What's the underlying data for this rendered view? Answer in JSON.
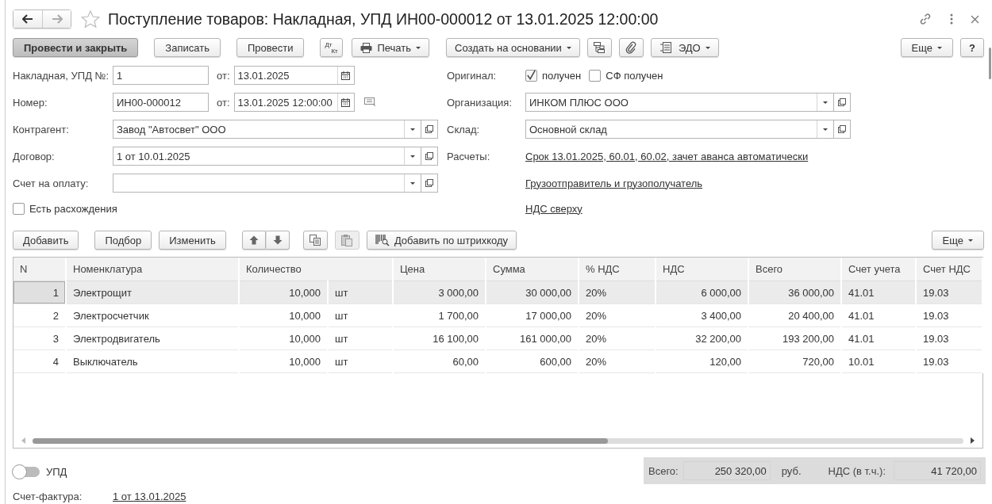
{
  "window": {
    "title": "Поступление товаров: Накладная, УПД ИН00-000012 от 13.01.2025 12:00:00"
  },
  "toolbar": [
    {
      "kind": "primary",
      "label": "Провести и закрыть"
    },
    {
      "kind": "button",
      "label": "Записать"
    },
    {
      "kind": "button",
      "label": "Провести"
    },
    {
      "kind": "dtkt",
      "top": "Дт",
      "bottom": "Кт"
    },
    {
      "kind": "print",
      "label": "Печать"
    },
    {
      "kind": "menu",
      "label": "Создать на основании"
    },
    {
      "kind": "structure"
    },
    {
      "kind": "attach"
    },
    {
      "kind": "edo",
      "label": "ЭДО"
    }
  ],
  "toolbar_right": {
    "more": "Еще",
    "help": "?"
  },
  "left_fields": [
    {
      "kind": "number",
      "label": "Накладная, УПД №:",
      "value": "1",
      "date_label": "от:",
      "date": "13.01.2025"
    },
    {
      "kind": "number",
      "label": "Номер:",
      "value": "ИН00-000012",
      "date_label": "от:",
      "date": "13.01.2025 12:00:00",
      "comment": true
    },
    {
      "kind": "select",
      "label": "Контрагент:",
      "value": "Завод \"Автосвет\" ООО"
    },
    {
      "kind": "select",
      "label": "Договор:",
      "value": "1 от 10.01.2025"
    },
    {
      "kind": "select",
      "label": "Счет на оплату:"
    },
    {
      "kind": "checkbox",
      "label": "Есть расхождения",
      "checked": false
    }
  ],
  "right_fields": [
    {
      "kind": "checks",
      "label": "Оригинал:",
      "items": [
        {
          "label": "получен",
          "checked": true
        },
        {
          "label": "СФ получен",
          "checked": false
        }
      ]
    },
    {
      "kind": "select",
      "label": "Организация:",
      "value": "ИНКОМ ПЛЮС ООО"
    },
    {
      "kind": "select",
      "label": "Склад:",
      "value": "Основной склад"
    },
    {
      "kind": "link",
      "label": "Расчеты:",
      "value": "Срок 13.01.2025, 60.01, 60.02, зачет аванса автоматически"
    },
    {
      "kind": "link",
      "value": "Грузоотправитель и грузополучатель"
    },
    {
      "kind": "link",
      "value": "НДС сверху"
    }
  ],
  "table_toolbar": {
    "items": [
      {
        "kind": "button",
        "label": "Добавить"
      },
      {
        "kind": "button",
        "label": "Подбор"
      },
      {
        "kind": "button",
        "label": "Изменить"
      },
      {
        "kind": "updown"
      },
      {
        "kind": "copy",
        "disabled": false
      },
      {
        "kind": "paste",
        "disabled": true
      },
      {
        "kind": "barcode",
        "label": "Добавить по штрихкоду"
      }
    ],
    "more": "Еще"
  },
  "table": {
    "columns": [
      "N",
      "Номенклатура",
      "Количество",
      "Цена",
      "Сумма",
      "% НДС",
      "НДС",
      "Всего",
      "Счет учета",
      "Счет НДС"
    ],
    "rows": [
      {
        "selected": true,
        "n": "1",
        "name": "Электрощит",
        "qty": "10,000",
        "unit": "шт",
        "price": "3 000,00",
        "sum": "30 000,00",
        "vat_rate": "20%",
        "vat": "6 000,00",
        "total": "36 000,00",
        "account": "41.01",
        "vat_account": "19.03"
      },
      {
        "selected": false,
        "n": "2",
        "name": "Электросчетчик",
        "qty": "10,000",
        "unit": "шт",
        "price": "1 700,00",
        "sum": "17 000,00",
        "vat_rate": "20%",
        "vat": "3 400,00",
        "total": "20 400,00",
        "account": "41.01",
        "vat_account": "19.03"
      },
      {
        "selected": false,
        "n": "3",
        "name": "Электродвигатель",
        "qty": "10,000",
        "unit": "шт",
        "price": "16 100,00",
        "sum": "161 000,00",
        "vat_rate": "20%",
        "vat": "32 200,00",
        "total": "193 200,00",
        "account": "41.01",
        "vat_account": "19.03"
      },
      {
        "selected": false,
        "n": "4",
        "name": "Выключатель",
        "qty": "10,000",
        "unit": "шт",
        "price": "60,00",
        "sum": "600,00",
        "vat_rate": "20%",
        "vat": "120,00",
        "total": "720,00",
        "account": "10.01",
        "vat_account": "19.03"
      }
    ]
  },
  "footer": {
    "toggle": {
      "label": "УПД",
      "on": false
    },
    "totals": {
      "total_label": "Всего:",
      "total": "250 320,00",
      "currency": "руб.",
      "vat_label": "НДС (в т.ч.):",
      "vat": "41 720,00"
    },
    "invoice": {
      "label": "Счет-фактура:",
      "value": "1 от 13.01.2025"
    }
  }
}
